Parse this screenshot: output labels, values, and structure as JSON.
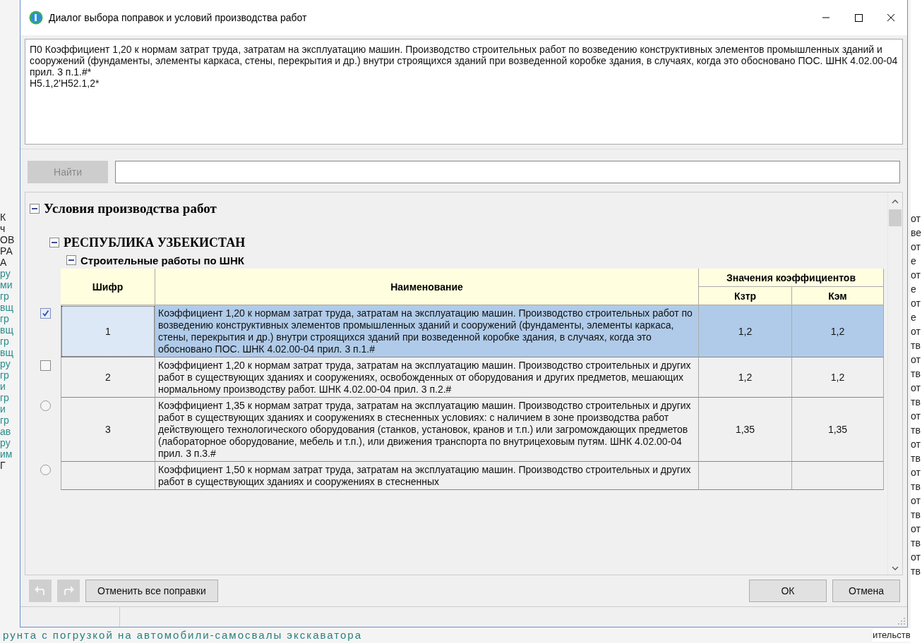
{
  "background_window": {
    "left_fragments": [
      "К",
      "ч",
      "ОВ",
      "РА",
      "А",
      "ру",
      "ми",
      "гр",
      "вщ",
      "гр",
      "вщ",
      "гр",
      "вщ",
      "ру",
      "гр",
      "и",
      "гр",
      "и",
      "гр",
      "ав",
      "ру",
      "им",
      "Г"
    ],
    "right_fragments": [
      "от",
      "ве",
      "от",
      "е",
      "от",
      "е",
      "от",
      "е",
      "от",
      "тв",
      "от",
      "тв",
      "от",
      "тв",
      "от",
      "тв",
      "от",
      "тв",
      "от",
      "тв",
      "от",
      "тв",
      "от",
      "тв",
      "от",
      "тв"
    ],
    "bottom_text": "рунта с погрузкой на автомобили-самосвалы экскаватора",
    "bottom_right_text": "ительств"
  },
  "window": {
    "title": "Диалог выбора поправок и условий производства работ"
  },
  "description": "П0 Коэффициент 1,20 к нормам затрат труда, затратам на эксплуатацию машин. Производство строительных работ по возведению конструктивных элементов промышленных зданий и сооружений (фундаменты, элементы каркаса, стены, перекрытия и др.) внутри строящихся зданий при возведенной коробке здания, в случаях, когда это обосновано ПОС. ШНК 4.02.00-04 прил. 3 п.1.#*\nН5.1,2'Н52.1,2*",
  "search": {
    "button": "Найти",
    "disabled": true
  },
  "tree": {
    "label": "Условия производства работ",
    "expanded": true,
    "children": [
      {
        "label": "РЕСПУБЛИКА УЗБЕКИСТАН",
        "expanded": true,
        "children": [
          {
            "label": "Строительные работы по ШНК",
            "expanded": true
          }
        ]
      }
    ]
  },
  "table": {
    "columns": {
      "code": "Шифр",
      "name": "Наименование",
      "group": "Значения коэффициентов",
      "k1": "Кзтр",
      "k2": "Кэм"
    },
    "rows": [
      {
        "kind": "checkbox",
        "checked": true,
        "selected": true,
        "code": "1",
        "name": "Коэффициент 1,20 к нормам затрат труда, затратам на эксплуатацию машин. Производство строительных работ по возведению конструктивных элементов промышленных зданий и сооружений (фундаменты, элементы каркаса, стены, перекрытия и др.) внутри строящихся зданий при возведенной коробке здания, в случаях, когда это обосновано ПОС. ШНК 4.02.00-04 прил. 3 п.1.#",
        "k1": "1,2",
        "k2": "1,2"
      },
      {
        "kind": "checkbox",
        "checked": false,
        "selected": false,
        "code": "2",
        "name": "Коэффициент 1,20 к нормам затрат труда, затратам на эксплуатацию машин. Производство строительных и других работ в существующих зданиях и сооружениях, освобожденных от оборудования и других предметов, мешающих нормальному производству работ. ШНК 4.02.00-04 прил. 3 п.2.#",
        "k1": "1,2",
        "k2": "1,2"
      },
      {
        "kind": "radio",
        "checked": false,
        "selected": false,
        "code": "3",
        "name": "Коэффициент 1,35 к нормам затрат труда, затратам на эксплуатацию машин. Производство строительных и других работ в существующих зданиях и сооружениях в стесненных условиях: с наличием в зоне производства работ действующего технологического оборудования (станков, установок, кранов и т.п.) или загромождающих предметов (лабораторное оборудование, мебель и т.п.), или движения транспорта по внутрицеховым путям. ШНК 4.02.00-04 прил. 3 п.3.#",
        "k1": "1,35",
        "k2": "1,35"
      },
      {
        "kind": "radio",
        "checked": false,
        "selected": false,
        "code": "",
        "name": "Коэффициент 1,50 к нормам затрат труда, затратам на эксплуатацию машин. Производство строительных и других работ в существующих зданиях и сооружениях в стесненных",
        "k1": "",
        "k2": ""
      }
    ]
  },
  "footer": {
    "undo_disabled": true,
    "redo_disabled": true,
    "reset": "Отменить все поправки",
    "ok": "ОК",
    "cancel": "Отмена"
  }
}
